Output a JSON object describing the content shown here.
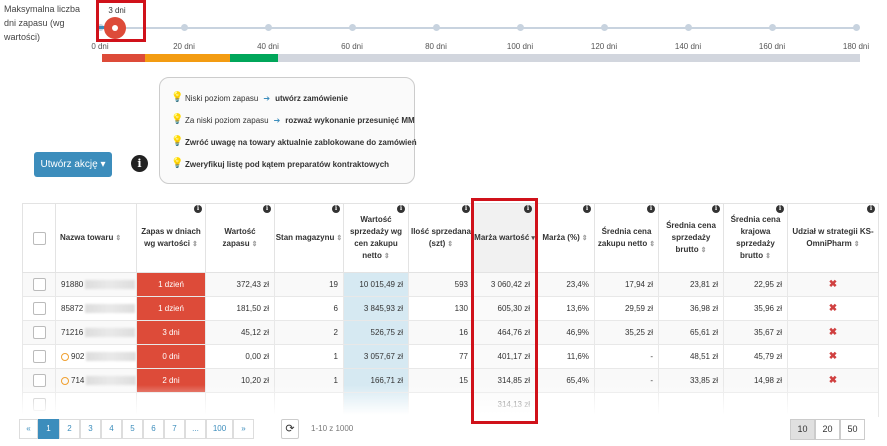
{
  "slider": {
    "label": "Maksymalna liczba dni zapasu (wg wartości)",
    "current_value": "3 dni",
    "value_days": 3,
    "max_days": 180,
    "ticks": [
      "0 dni",
      "20 dni",
      "40 dni",
      "60 dni",
      "80 dni",
      "100 dni",
      "120 dni",
      "140 dni",
      "160 dni",
      "180 dni"
    ]
  },
  "legend_colors": [
    "#dd4b39",
    "#f39c12",
    "#00a65a",
    "#d2d6de"
  ],
  "tips": [
    {
      "plain": "Niski poziom zapasu",
      "bold": "utwórz zamówienie"
    },
    {
      "plain": "Za niski poziom zapasu",
      "bold": "rozważ wykonanie przesunięć MM"
    },
    {
      "plain": "",
      "bold": "Zwróć uwagę na towary aktualnie zablokowane do zamówień"
    },
    {
      "plain": "",
      "bold": "Zweryfikuj listę pod kątem preparatów kontraktowych"
    }
  ],
  "action_button": "Utwórz akcję ▾",
  "info_icon": "i",
  "table": {
    "headers": [
      "Nazwa towaru",
      "Zapas w dniach wg wartości",
      "Wartość zapasu",
      "Stan magazynu",
      "Wartość sprzedaży wg cen zakupu netto",
      "Ilość sprzedana (szt)",
      "Marża wartość",
      "Marża (%)",
      "Średnia cena zakupu netto",
      "Średnia cena sprzedaży brutto",
      "Średnia cena krajowa sprzedaży brutto",
      "Udział w strategii KS-OmniPharm"
    ],
    "rows": [
      [
        "91880",
        "1 dzień",
        "372,43 zł",
        "19",
        "10 015,49 zł",
        "593",
        "3 060,42 zł",
        "23,4%",
        "17,94 zł",
        "23,81 zł",
        "22,95 zł",
        "✖"
      ],
      [
        "85872",
        "1 dzień",
        "181,50 zł",
        "6",
        "3 845,93 zł",
        "130",
        "605,30 zł",
        "13,6%",
        "29,59 zł",
        "36,98 zł",
        "35,96 zł",
        "✖"
      ],
      [
        "71216",
        "3 dni",
        "45,12 zł",
        "2",
        "526,75 zł",
        "16",
        "464,76 zł",
        "46,9%",
        "35,25 zł",
        "65,61 zł",
        "35,67 zł",
        "✖"
      ],
      [
        "902",
        "0 dni",
        "0,00 zł",
        "1",
        "3 057,67 zł",
        "77",
        "401,17 zł",
        "11,6%",
        "-",
        "48,51 zł",
        "45,79 zł",
        "✖"
      ],
      [
        "714",
        "2 dni",
        "10,20 zł",
        "1",
        "166,71 zł",
        "15",
        "314,85 zł",
        "65,4%",
        "-",
        "33,85 zł",
        "14,98 zł",
        "✖"
      ],
      [
        "",
        "",
        "",
        "",
        "",
        "",
        "314,13 zł",
        "",
        "",
        "",
        "",
        ""
      ]
    ]
  },
  "pagination": {
    "prev": "«",
    "pages": [
      "1",
      "2",
      "3",
      "4",
      "5",
      "6",
      "7",
      "...",
      "100"
    ],
    "next": "»",
    "range": "1-10 z 1000",
    "page_sizes": [
      "10",
      "20",
      "50"
    ]
  }
}
